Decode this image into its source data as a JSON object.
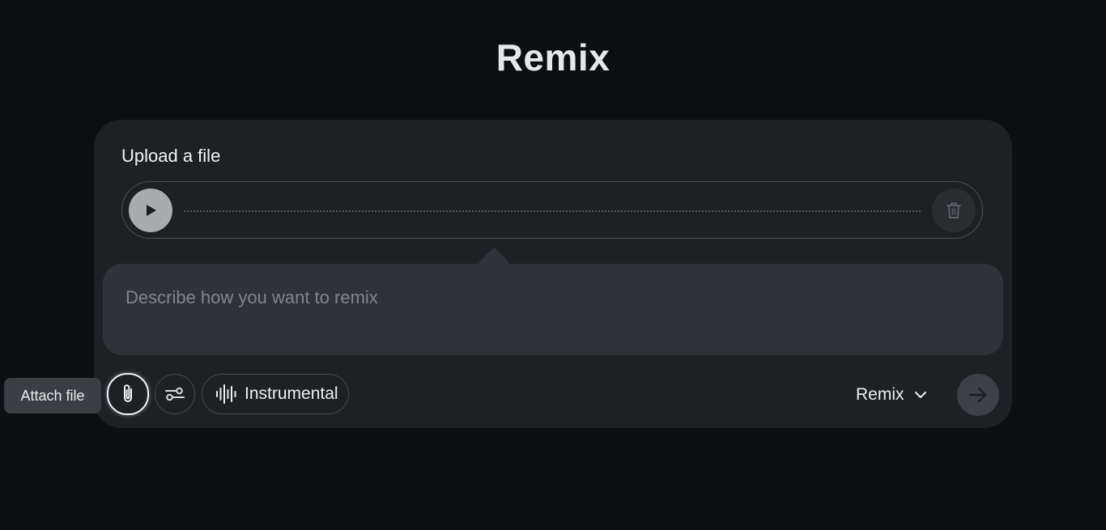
{
  "page": {
    "title": "Remix"
  },
  "upload": {
    "label": "Upload a file"
  },
  "prompt": {
    "placeholder": "Describe how you want to remix",
    "value": ""
  },
  "toolbar": {
    "attach_tooltip": "Attach file",
    "instrumental_label": "Instrumental",
    "mode_label": "Remix"
  },
  "icons": {
    "play": "play-icon",
    "trash": "trash-icon",
    "attach": "paperclip-icon",
    "settings": "sliders-icon",
    "instrumental": "waveform-icon",
    "mode": "chevron-down-icon",
    "send": "arrow-right-icon"
  },
  "colors": {
    "background": "#0d0e10",
    "card": "#1e2024",
    "prompt_field": "#303237",
    "play_button": "#a9abaf",
    "send_button": "#3e4046"
  }
}
